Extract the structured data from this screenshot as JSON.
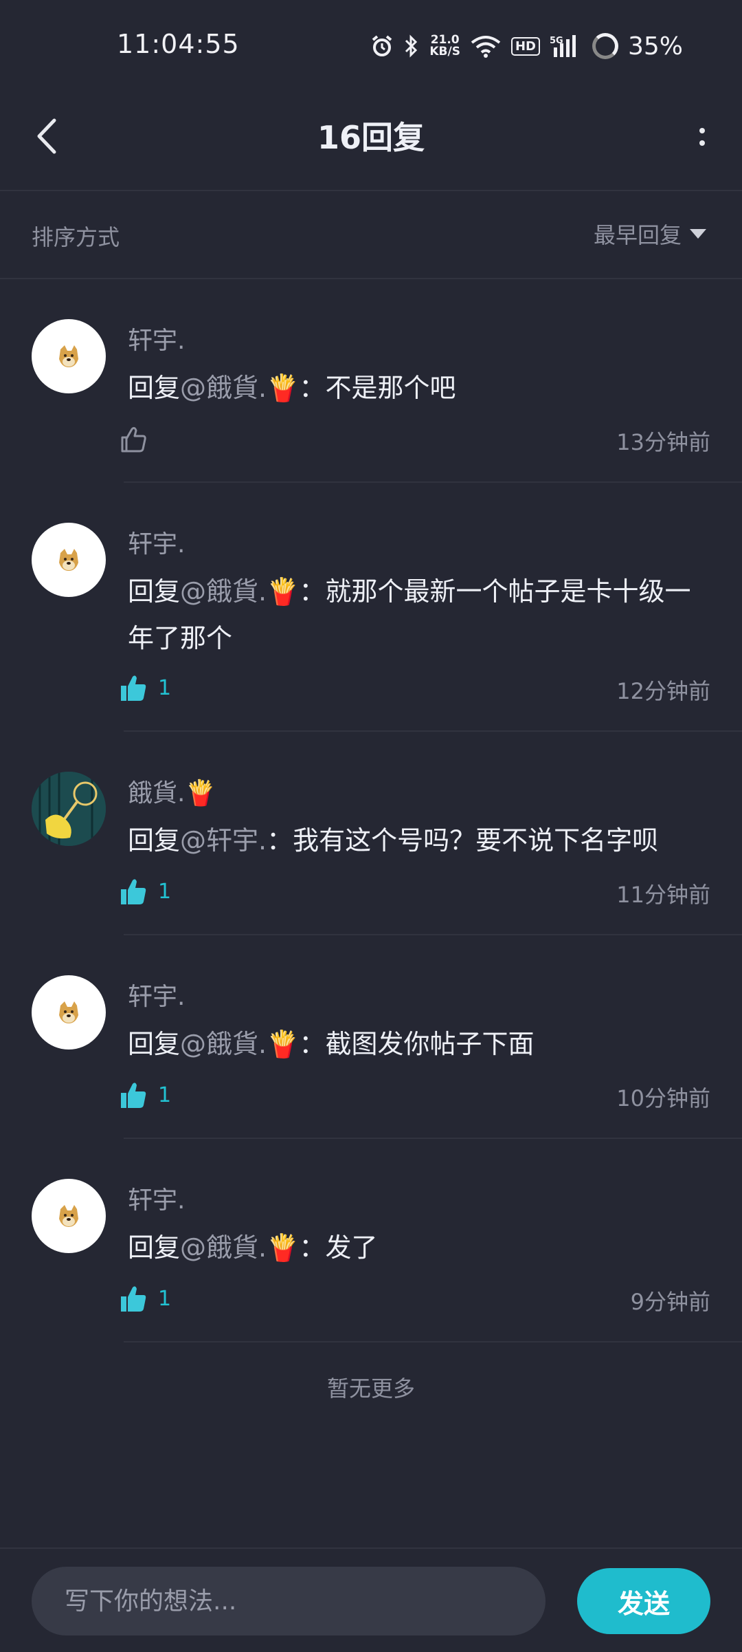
{
  "status_bar": {
    "time": "11:04:55",
    "net_speed_value": "21.0",
    "net_speed_unit": "KB/S",
    "hd_label": "HD",
    "signal_label": "5G",
    "battery": "35%"
  },
  "header": {
    "title": "16回复"
  },
  "sort": {
    "label": "排序方式",
    "selected": "最早回复"
  },
  "comments": [
    {
      "username": "轩宇.",
      "prefix": "回复",
      "mention": "@餓貨.🍟",
      "separator": "：",
      "text": "不是那个吧",
      "like_count": "",
      "time": "13分钟前"
    },
    {
      "username": "轩宇.",
      "prefix": "回复",
      "mention": "@餓貨.🍟",
      "separator": "：",
      "text": "就那个最新一个帖子是卡十级一年了那个",
      "like_count": "1",
      "time": "12分钟前"
    },
    {
      "username": "餓貨.🍟",
      "prefix": "回复",
      "mention": "@轩宇.",
      "separator": "：",
      "text": "我有这个号吗？要不说下名字呗",
      "like_count": "1",
      "time": "11分钟前"
    },
    {
      "username": "轩宇.",
      "prefix": "回复",
      "mention": "@餓貨.🍟",
      "separator": "：",
      "text": "截图发你帖子下面",
      "like_count": "1",
      "time": "10分钟前"
    },
    {
      "username": "轩宇.",
      "prefix": "回复",
      "mention": "@餓貨.🍟",
      "separator": "：",
      "text": "发了",
      "like_count": "1",
      "time": "9分钟前"
    }
  ],
  "footer": {
    "no_more": "暂无更多"
  },
  "input": {
    "placeholder": "写下你的想法...",
    "send_label": "发送"
  },
  "colors": {
    "background": "#252733",
    "accent": "#1fbccd",
    "like_active": "#3cc8da"
  }
}
